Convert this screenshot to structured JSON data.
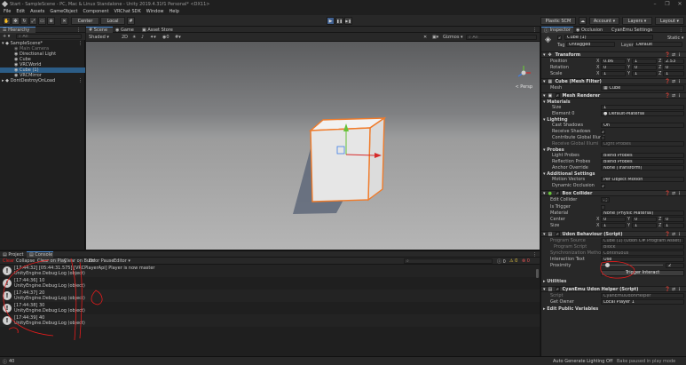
{
  "window": {
    "title": "Start - SampleScene - PC, Mac & Linux Standalone - Unity 2019.4.31f1 Personal* <DX11>",
    "minimize_glyph": "–",
    "maximize_glyph": "❐",
    "close_glyph": "✕"
  },
  "menu": [
    "File",
    "Edit",
    "Assets",
    "GameObject",
    "Component",
    "VRChat SDK",
    "Window",
    "Help"
  ],
  "toolbar": {
    "pivot_label": "Center",
    "space_label": "Local",
    "play_glyph": "▶",
    "pause_glyph": "❚❚",
    "step_glyph": "▶❚",
    "collab_label": "Plastic SCM",
    "account_label": "Account",
    "layers_label": "Layers",
    "layout_label": "Layout"
  },
  "hierarchy": {
    "tab": "Hierarchy",
    "add_glyph": "+ ▾",
    "search_placeholder": "All",
    "scene_name": "SampleScene*",
    "items": [
      "Main Camera",
      "Directional Light",
      "Cube",
      "VRCWorld",
      "Cube (1)",
      "VRCMirror"
    ],
    "second_scene": "DontDestroyOnLoad"
  },
  "scene_view": {
    "tabs": [
      "Scene",
      "Game",
      "Asset Store"
    ],
    "shading": "Shaded",
    "mode_2d": "2D",
    "gizmos_label": "Gizmos",
    "search_placeholder": "All",
    "persp_label": "< Persp"
  },
  "console": {
    "tabs": [
      "Project",
      "Console"
    ],
    "buttons": [
      "Clear",
      "Collapse",
      "Clear on Play",
      "Clear on Build",
      "Error Pause",
      "Editor"
    ],
    "counts": {
      "info": "0",
      "warn": "0",
      "error": "0"
    },
    "entries": [
      {
        "line1": "[17:44:32] [05:44:31.575] [VRCPlayerApi] Player is now master",
        "line2": "UnityEngine.Debug:Log (object)"
      },
      {
        "line1": "[17:44:36] 10",
        "line2": "UnityEngine.Debug:Log (object)"
      },
      {
        "line1": "[17:44:37] 20",
        "line2": "UnityEngine.Debug:Log (object)"
      },
      {
        "line1": "[17:44:38] 30",
        "line2": "UnityEngine.Debug:Log (object)"
      },
      {
        "line1": "[17:44:39] 40",
        "line2": "UnityEngine.Debug:Log (object)"
      }
    ]
  },
  "inspector": {
    "tabs": [
      "Inspector",
      "Occlusion",
      "CyanEmu Settings"
    ],
    "object_name": "Cube (1)",
    "static_label": "Static ▾",
    "tag_label": "Tag",
    "tag_value": "Untagged",
    "layer_label": "Layer",
    "layer_value": "Default",
    "transform": {
      "title": "Transform",
      "rows": [
        {
          "label": "Position",
          "x": "0.86",
          "y": "1",
          "z": "2.53"
        },
        {
          "label": "Rotation",
          "x": "0",
          "y": "0",
          "z": "0"
        },
        {
          "label": "Scale",
          "x": "1",
          "y": "1",
          "z": "1"
        }
      ]
    },
    "mesh_filter": {
      "title": "Cube (Mesh Filter)",
      "mesh_label": "Mesh",
      "mesh_value": "Cube"
    },
    "mesh_renderer": {
      "title": "Mesh Renderer",
      "materials_label": "Materials",
      "size_label": "Size",
      "size_value": "1",
      "element_label": "Element 0",
      "element_value": "Default-Material",
      "lighting_label": "Lighting",
      "cast_shadows_label": "Cast Shadows",
      "cast_shadows_value": "On",
      "receive_shadows_label": "Receive Shadows",
      "contribute_gi_label": "Contribute Global Illumi",
      "receive_gi_label": "Receive Global Illumi",
      "receive_gi_value": "Light Probes",
      "probes_label": "Probes",
      "light_probes_label": "Light Probes",
      "light_probes_value": "Blend Probes",
      "reflection_probes_label": "Reflection Probes",
      "reflection_probes_value": "Blend Probes",
      "anchor_override_label": "Anchor Override",
      "anchor_override_value": "None (Transform)",
      "additional_label": "Additional Settings",
      "motion_vectors_label": "Motion Vectors",
      "motion_vectors_value": "Per Object Motion",
      "dynamic_occlusion_label": "Dynamic Occlusion"
    },
    "box_collider": {
      "title": "Box Collider",
      "edit_label": "Edit Collider",
      "is_trigger_label": "Is Trigger",
      "material_label": "Material",
      "material_value": "None (Physic Material)",
      "center_label": "Center",
      "center": {
        "x": "0",
        "y": "0",
        "z": "0"
      },
      "size_label": "Size",
      "size": {
        "x": "1",
        "y": "1",
        "z": "1"
      }
    },
    "udon": {
      "title": "Udon Behaviour (Script)",
      "program_source_label": "Program Source",
      "program_source_value": "Cube (1) (Udon C# Program Asset)",
      "program_script_label": "Program Script",
      "program_script_value": "Block",
      "sync_label": "Synchronization Method",
      "sync_value": "Continuous",
      "interaction_text_label": "Interaction Text",
      "interaction_text_value": "Use",
      "proximity_label": "Proximity",
      "proximity_value": "2",
      "proximity_fraction": 0.1,
      "trigger_button": "Trigger Interact"
    },
    "utilities_label": "Utilities",
    "cyan": {
      "title": "CyanEmu Udon Helper (Script)",
      "script_label": "Script",
      "script_value": "CyanEmuUdonHelper",
      "owner_label": "Get Owner",
      "owner_value": "Local Player 1",
      "edit_vars_label": "Edit Public Variables"
    }
  },
  "status": {
    "left_value": "40",
    "bake_label": "Auto Generate Lighting Off",
    "bake_paused_label": "Bake paused in play mode"
  },
  "colors": {
    "play_blue": "#4a8cd6",
    "selection_orange": "#f07b2a",
    "annotation_red": "#e51c1c",
    "axis_red": "#d62b2b",
    "axis_green": "#67c23a",
    "axis_blue": "#3f7ee8"
  }
}
